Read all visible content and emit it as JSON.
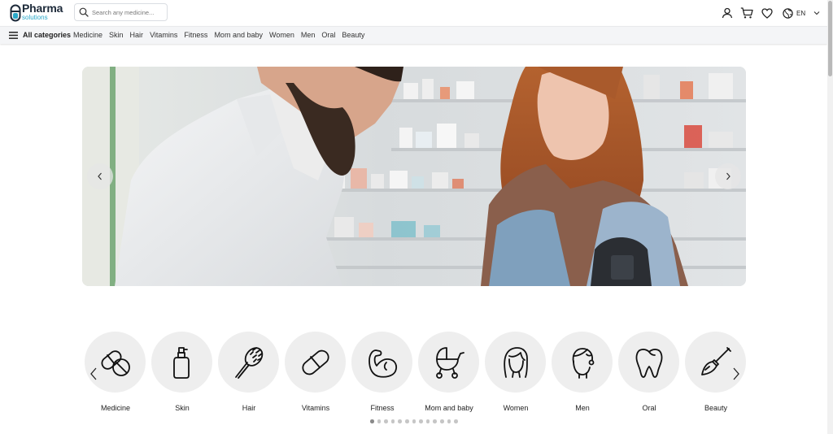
{
  "header": {
    "logo_title": "Pharma",
    "logo_subtitle": "solutions",
    "search_placeholder": "Search any medicine...",
    "language": "EN",
    "icons": [
      "user-icon",
      "cart-icon",
      "heart-icon",
      "globe-icon",
      "chevron-down-icon"
    ]
  },
  "category_nav": {
    "all_label": "All categories",
    "links": [
      "Medicine",
      "Skin",
      "Hair",
      "Vitamins",
      "Fitness",
      "Mom and baby",
      "Women",
      "Men",
      "Oral",
      "Beauty"
    ]
  },
  "hero": {
    "prev_icon": "chevron-left-icon",
    "next_icon": "chevron-right-icon"
  },
  "categories": [
    {
      "label": "Medicine",
      "icon": "pills-icon"
    },
    {
      "label": "Skin",
      "icon": "lotion-bottle-icon"
    },
    {
      "label": "Hair",
      "icon": "hairbrush-icon"
    },
    {
      "label": "Vitamins",
      "icon": "capsule-icon"
    },
    {
      "label": "Fitness",
      "icon": "flexed-arm-icon"
    },
    {
      "label": "Mom and baby",
      "icon": "stroller-icon"
    },
    {
      "label": "Women",
      "icon": "woman-face-icon"
    },
    {
      "label": "Men",
      "icon": "man-face-icon"
    },
    {
      "label": "Oral",
      "icon": "tooth-icon"
    },
    {
      "label": "Beauty",
      "icon": "makeup-brush-icon"
    }
  ],
  "carousel_dots": {
    "count": 13,
    "active": 0
  },
  "colors": {
    "brand_dark": "#1d2a3a",
    "brand_accent": "#2aa8c9",
    "circle_bg": "#eeeeee"
  }
}
